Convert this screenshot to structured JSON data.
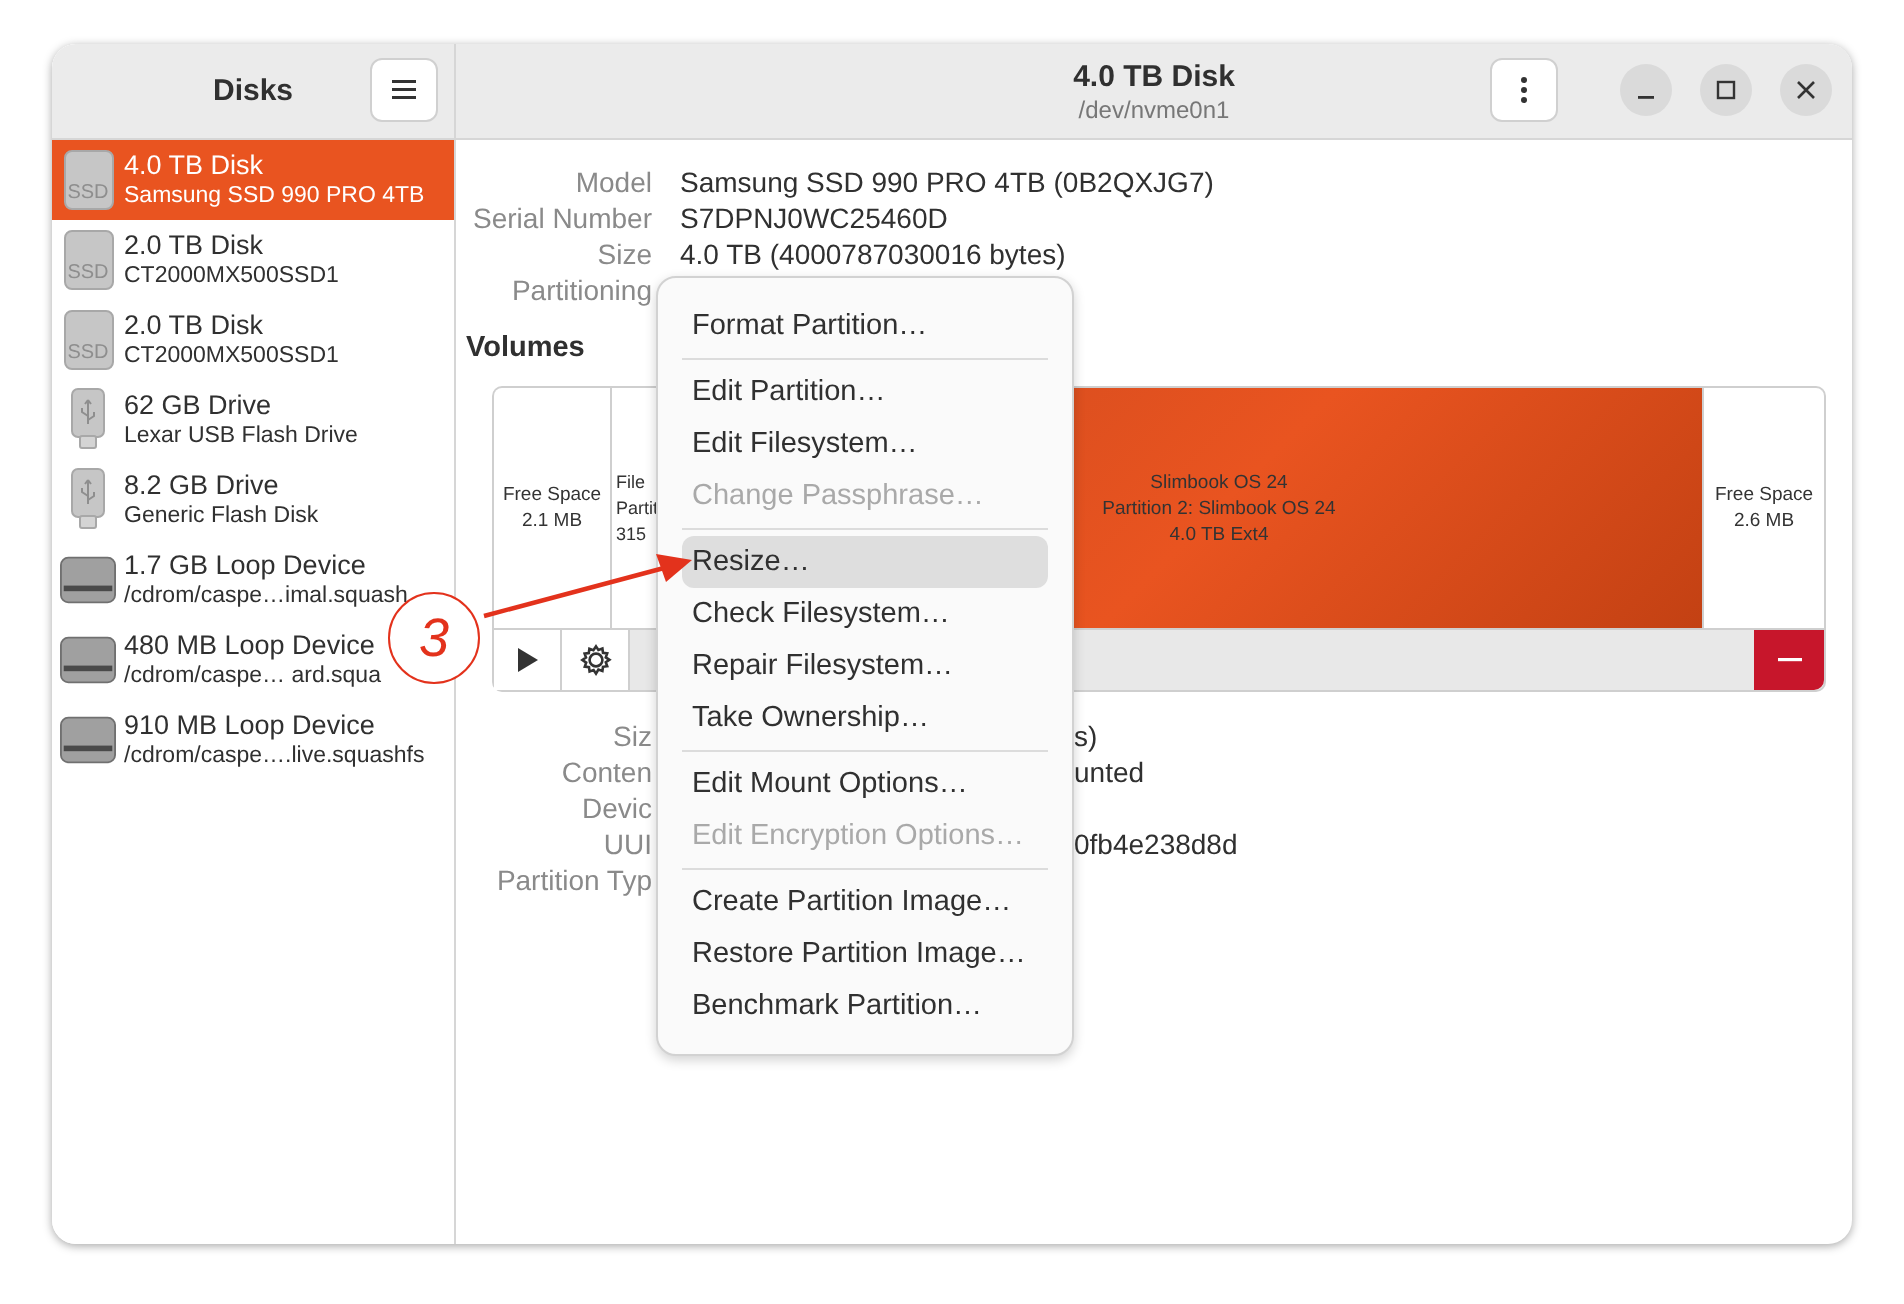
{
  "window": {
    "title": "4.0 TB Disk",
    "subtitle": "/dev/nvme0n1"
  },
  "sidebar": {
    "title": "Disks",
    "items": [
      {
        "kind": "ssd",
        "icon_label": "SSD",
        "name": "4.0 TB Disk",
        "detail": "Samsung SSD 990 PRO 4TB",
        "selected": true
      },
      {
        "kind": "ssd",
        "icon_label": "SSD",
        "name": "2.0 TB Disk",
        "detail": "CT2000MX500SSD1",
        "selected": false
      },
      {
        "kind": "ssd",
        "icon_label": "SSD",
        "name": "2.0 TB Disk",
        "detail": "CT2000MX500SSD1",
        "selected": false
      },
      {
        "kind": "usb",
        "name": "62 GB Drive",
        "detail": "Lexar USB Flash Drive",
        "selected": false
      },
      {
        "kind": "usb",
        "name": "8.2 GB Drive",
        "detail": "Generic Flash Disk",
        "selected": false
      },
      {
        "kind": "loop",
        "name": "1.7 GB Loop Device",
        "detail": "/cdrom/caspe…imal.squash",
        "selected": false
      },
      {
        "kind": "loop",
        "name": "480 MB Loop Device",
        "detail": "/cdrom/caspe… ard.squa",
        "selected": false
      },
      {
        "kind": "loop",
        "name": "910 MB Loop Device",
        "detail": "/cdrom/caspe….live.squashfs",
        "selected": false
      }
    ]
  },
  "disk_details": [
    {
      "label": "Model",
      "value": "Samsung SSD 990 PRO 4TB (0B2QXJG7)"
    },
    {
      "label": "Serial Number",
      "value": "S7DPNJ0WC25460D"
    },
    {
      "label": "Size",
      "value": "4.0 TB (4000787030016 bytes)"
    },
    {
      "label": "Partitioning"
    }
  ],
  "volumes": {
    "heading": "Volumes",
    "segments": [
      {
        "kind": "free",
        "selected": false,
        "lines": [
          "Free Space",
          "2.1 MB"
        ]
      },
      {
        "kind": "partition",
        "selected": false,
        "lines": [
          "File",
          "Partit",
          "315"
        ]
      },
      {
        "kind": "partition",
        "selected": true,
        "lines": [
          "Slimbook OS 24",
          "Partition 2: Slimbook OS 24",
          "4.0 TB Ext4"
        ]
      },
      {
        "kind": "free",
        "selected": false,
        "lines": [
          "Free Space",
          "2.6 MB"
        ]
      }
    ]
  },
  "partition_details": [
    {
      "label": "Siz",
      "value": "s)"
    },
    {
      "label": "Conten",
      "value": "unted"
    },
    {
      "label": "Devic"
    },
    {
      "label": "UUI",
      "value": "0fb4e238d8d"
    },
    {
      "label": "Partition Typ"
    }
  ],
  "context_menu": [
    [
      {
        "label": "Format Partition…",
        "disabled": false,
        "selected": false
      }
    ],
    [
      {
        "label": "Edit Partition…",
        "disabled": false,
        "selected": false
      },
      {
        "label": "Edit Filesystem…",
        "disabled": false,
        "selected": false
      },
      {
        "label": "Change Passphrase…",
        "disabled": true,
        "selected": false
      }
    ],
    [
      {
        "label": "Resize…",
        "disabled": false,
        "selected": true
      },
      {
        "label": "Check Filesystem…",
        "disabled": false,
        "selected": false
      },
      {
        "label": "Repair Filesystem…",
        "disabled": false,
        "selected": false
      },
      {
        "label": "Take Ownership…",
        "disabled": false,
        "selected": false
      }
    ],
    [
      {
        "label": "Edit Mount Options…",
        "disabled": false,
        "selected": false
      },
      {
        "label": "Edit Encryption Options…",
        "disabled": true,
        "selected": false
      }
    ],
    [
      {
        "label": "Create Partition Image…",
        "disabled": false,
        "selected": false
      },
      {
        "label": "Restore Partition Image…",
        "disabled": false,
        "selected": false
      },
      {
        "label": "Benchmark Partition…",
        "disabled": false,
        "selected": false
      }
    ]
  ],
  "annotation": {
    "number": "3"
  }
}
